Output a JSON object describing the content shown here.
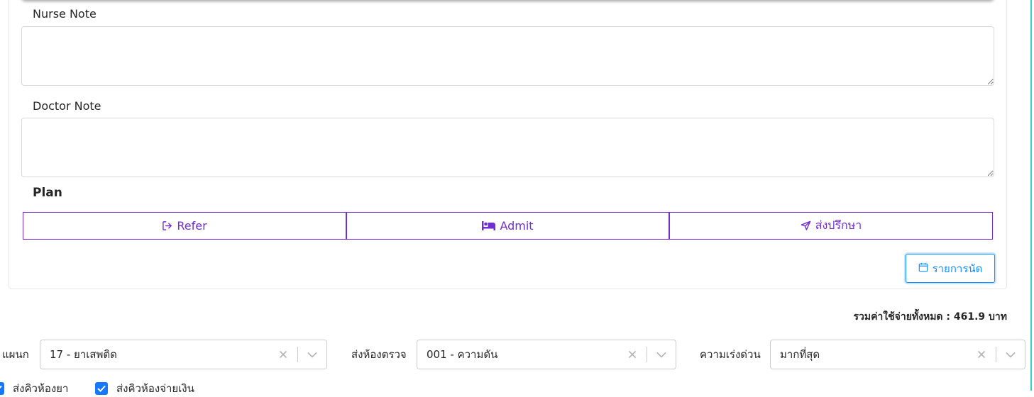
{
  "notes": {
    "nurse_label": "Nurse Note",
    "nurse_value": "",
    "doctor_label": "Doctor Note",
    "doctor_value": ""
  },
  "plan": {
    "title": "Plan",
    "buttons": [
      {
        "label": "Refer",
        "icon": "sign-out-icon"
      },
      {
        "label": "Admit",
        "icon": "bed-icon"
      },
      {
        "label": "ส่งปรึกษา",
        "icon": "send-icon"
      }
    ],
    "appointment_label": "รายการนัด",
    "appointment_icon": "calendar-icon"
  },
  "summary": {
    "total_text": "รวมค่าใช้จ่ายทั้งหมด : 461.9 บาท"
  },
  "selects": [
    {
      "label": "แผนก",
      "value": "17 - ยาเสพติด"
    },
    {
      "label": "ส่งห้องตรวจ",
      "value": "001 - ความดัน"
    },
    {
      "label": "ความเร่งด่วน",
      "value": "มากที่สุด"
    }
  ],
  "checkboxes": [
    {
      "label": "ส่งคิวห้องยา",
      "checked": true
    },
    {
      "label": "ส่งคิวห้องจ่ายเงิน",
      "checked": true
    }
  ],
  "colors": {
    "plan_button": "#722ed1",
    "appointment_button": "#1890ff",
    "checkbox": "#1677ff",
    "right_edge": "#36cfc9"
  }
}
